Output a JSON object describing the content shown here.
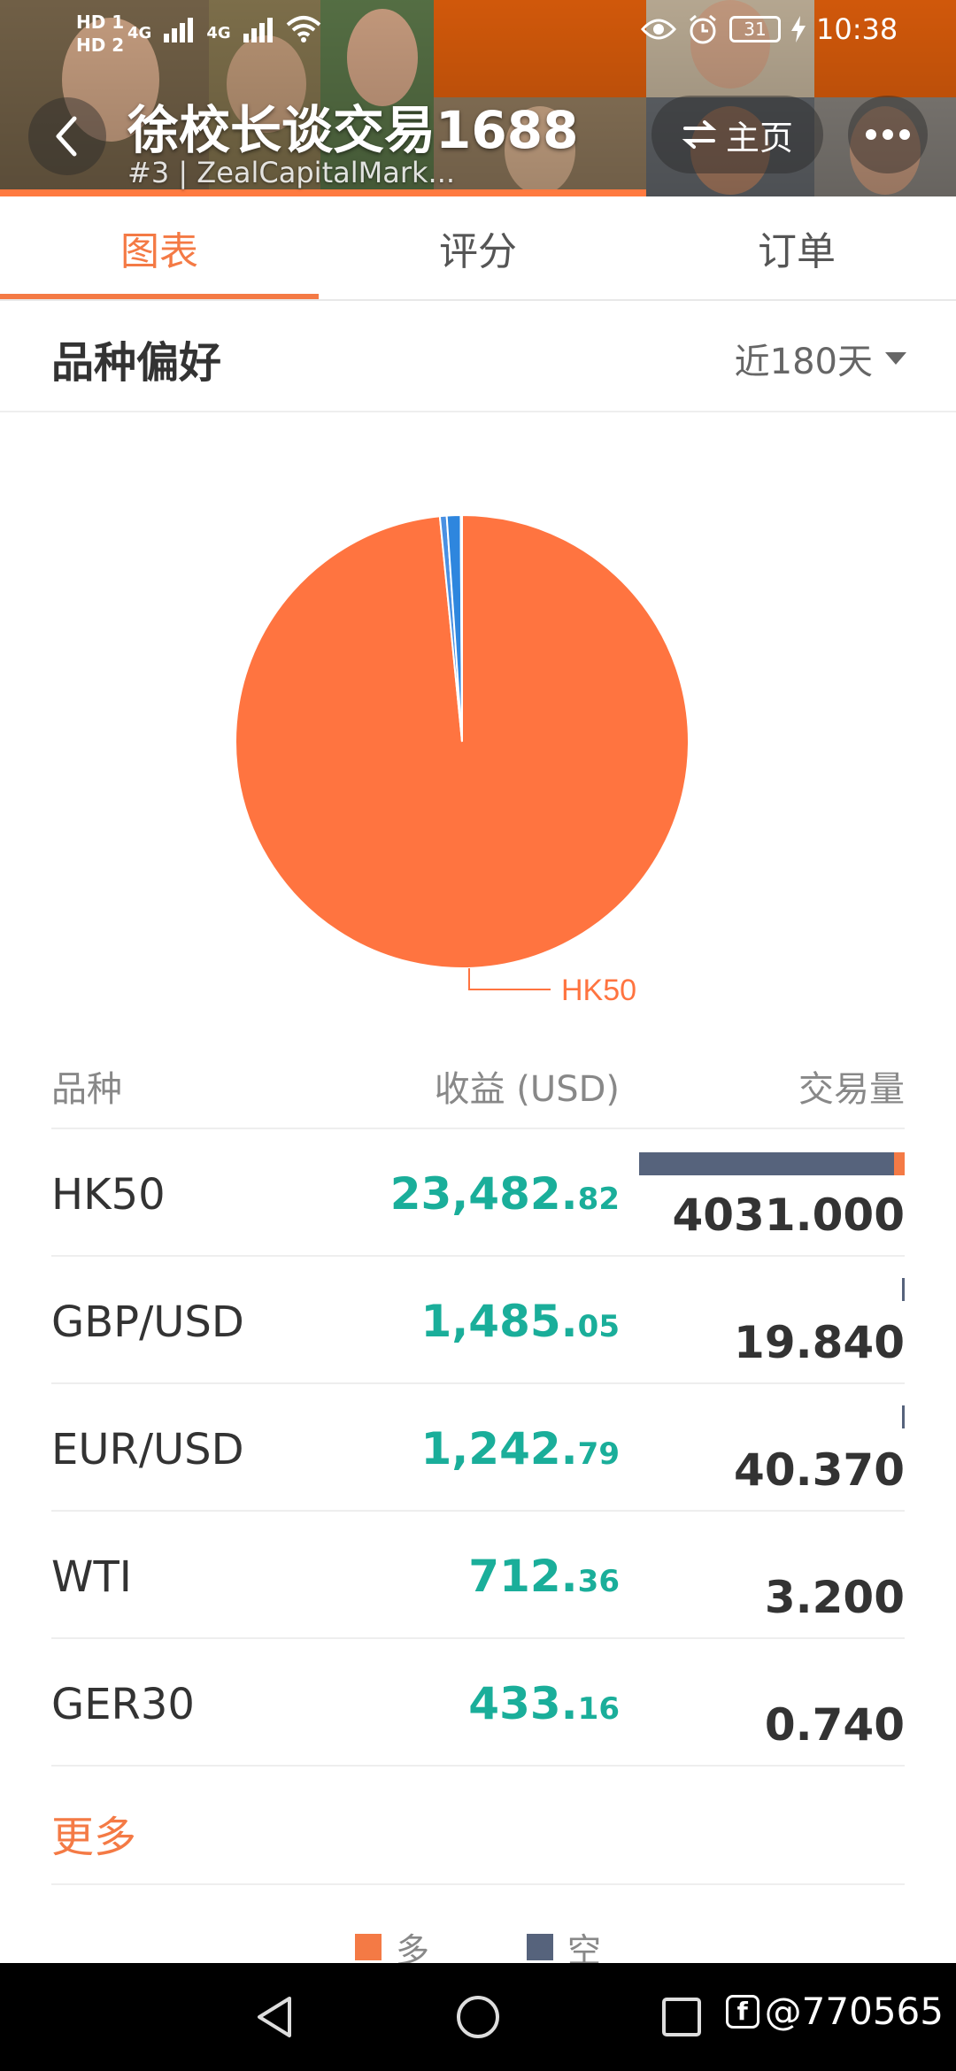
{
  "status_bar": {
    "left_indicators": [
      "HD 1",
      "HD 2",
      "4G",
      "4G"
    ],
    "battery": "31",
    "time": "10:38"
  },
  "header": {
    "title": "徐校长谈交易1688",
    "subtitle": "#3 | ZealCapitalMark...",
    "home_label": "主页",
    "back_icon": "chevron-left-icon",
    "more_icon": "more-dots-icon",
    "accent": "#ff7a40"
  },
  "tabs": [
    {
      "label": "图表",
      "active": true
    },
    {
      "label": "评分",
      "active": false
    },
    {
      "label": "订单",
      "active": false
    }
  ],
  "section": {
    "title": "品种偏好",
    "period": "近180天"
  },
  "chart_data": {
    "type": "pie",
    "labels": [
      "HK50",
      "GBP/USD",
      "EUR/USD",
      "WTI",
      "GER30"
    ],
    "values": [
      4031.0,
      19.84,
      40.37,
      3.2,
      0.74
    ],
    "colors": [
      "#ff7440",
      "#4a90e2",
      "#2e86de",
      "#1f9fa0",
      "#e8e8e8"
    ],
    "annotation": "HK50"
  },
  "table": {
    "headers": {
      "symbol": "品种",
      "profit": "收益 (USD)",
      "volume": "交易量"
    },
    "rows": [
      {
        "symbol": "HK50",
        "profit_int": "23,482.",
        "profit_dec": "82",
        "volume": "4031.000",
        "short_fraction": 0.96,
        "long_fraction": 0.04
      },
      {
        "symbol": "GBP/USD",
        "profit_int": "1,485.",
        "profit_dec": "05",
        "volume": "19.840",
        "short_fraction": 1.0,
        "long_fraction": 0.0
      },
      {
        "symbol": "EUR/USD",
        "profit_int": "1,242.",
        "profit_dec": "79",
        "volume": "40.370",
        "short_fraction": 1.0,
        "long_fraction": 0.0
      },
      {
        "symbol": "WTI",
        "profit_int": "712.",
        "profit_dec": "36",
        "volume": "3.200",
        "short_fraction": 0.0,
        "long_fraction": 0.0
      },
      {
        "symbol": "GER30",
        "profit_int": "433.",
        "profit_dec": "16",
        "volume": "0.740",
        "short_fraction": 0.0,
        "long_fraction": 0.0
      }
    ],
    "more_label": "更多"
  },
  "legend": [
    {
      "label": "多",
      "color": "#f47a45"
    },
    {
      "label": "空",
      "color": "#56637c"
    }
  ],
  "navbar": {
    "watermark": "@770565"
  }
}
